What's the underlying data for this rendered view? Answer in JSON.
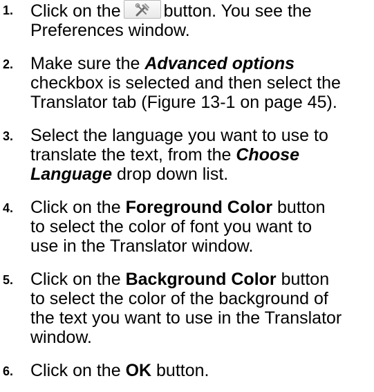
{
  "steps": [
    {
      "number": "1.",
      "pre": "Click on the",
      "icon": "tools-icon",
      "post": "button. You see the Preferences window."
    },
    {
      "number": "2.",
      "pre": "Make sure the",
      "emphasis": "Advanced options",
      "post": "checkbox is selected and then select the Translator tab (Figure 13-1 on page 45)."
    },
    {
      "number": "3.",
      "pre": "Select the language you want to use to translate the text, from the",
      "emphasis": "Choose Language",
      "post": "drop down list."
    },
    {
      "number": "4.",
      "pre": "Click on the",
      "bold": "Foreground Color",
      "post": "button to select the color of font you want to use in the Translator window."
    },
    {
      "number": "5.",
      "pre": "Click on the",
      "bold": "Background Color",
      "post": "button to select the color of the background of the text you want to use in the Translator window."
    },
    {
      "number": "6.",
      "pre": "Click on the",
      "bold": "OK",
      "post": "button."
    }
  ]
}
